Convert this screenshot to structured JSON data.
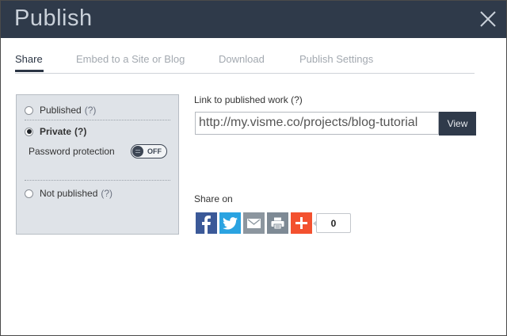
{
  "dialog": {
    "title": "Publish"
  },
  "tabs": [
    {
      "label": "Share",
      "active": true
    },
    {
      "label": "Embed to a Site or Blog",
      "active": false
    },
    {
      "label": "Download",
      "active": false
    },
    {
      "label": "Publish Settings",
      "active": false
    }
  ],
  "visibility": {
    "options": [
      {
        "label": "Published",
        "hint": "(?)",
        "checked": false
      },
      {
        "label": "Private",
        "hint": "(?)",
        "checked": true
      },
      {
        "label": "Not published",
        "hint": "(?)",
        "checked": false
      }
    ],
    "password_label": "Password protection",
    "password_toggle": "OFF"
  },
  "link": {
    "label": "Link to published work (?)",
    "url": "http://my.visme.co/projects/blog-tutorial",
    "view_label": "View"
  },
  "share": {
    "label": "Share on",
    "buttons": [
      {
        "icon": "facebook-icon",
        "color": "#3b5998"
      },
      {
        "icon": "twitter-icon",
        "color": "#2aa3e1"
      },
      {
        "icon": "email-icon",
        "color": "#8c969f"
      },
      {
        "icon": "print-icon",
        "color": "#7e8a95"
      },
      {
        "icon": "add-more-icon",
        "color": "#f3512f"
      }
    ],
    "count": "0"
  },
  "colors": {
    "titlebar": "#2f3a4a",
    "panel": "#dfe3e8",
    "view_button": "#2f3a4a"
  }
}
